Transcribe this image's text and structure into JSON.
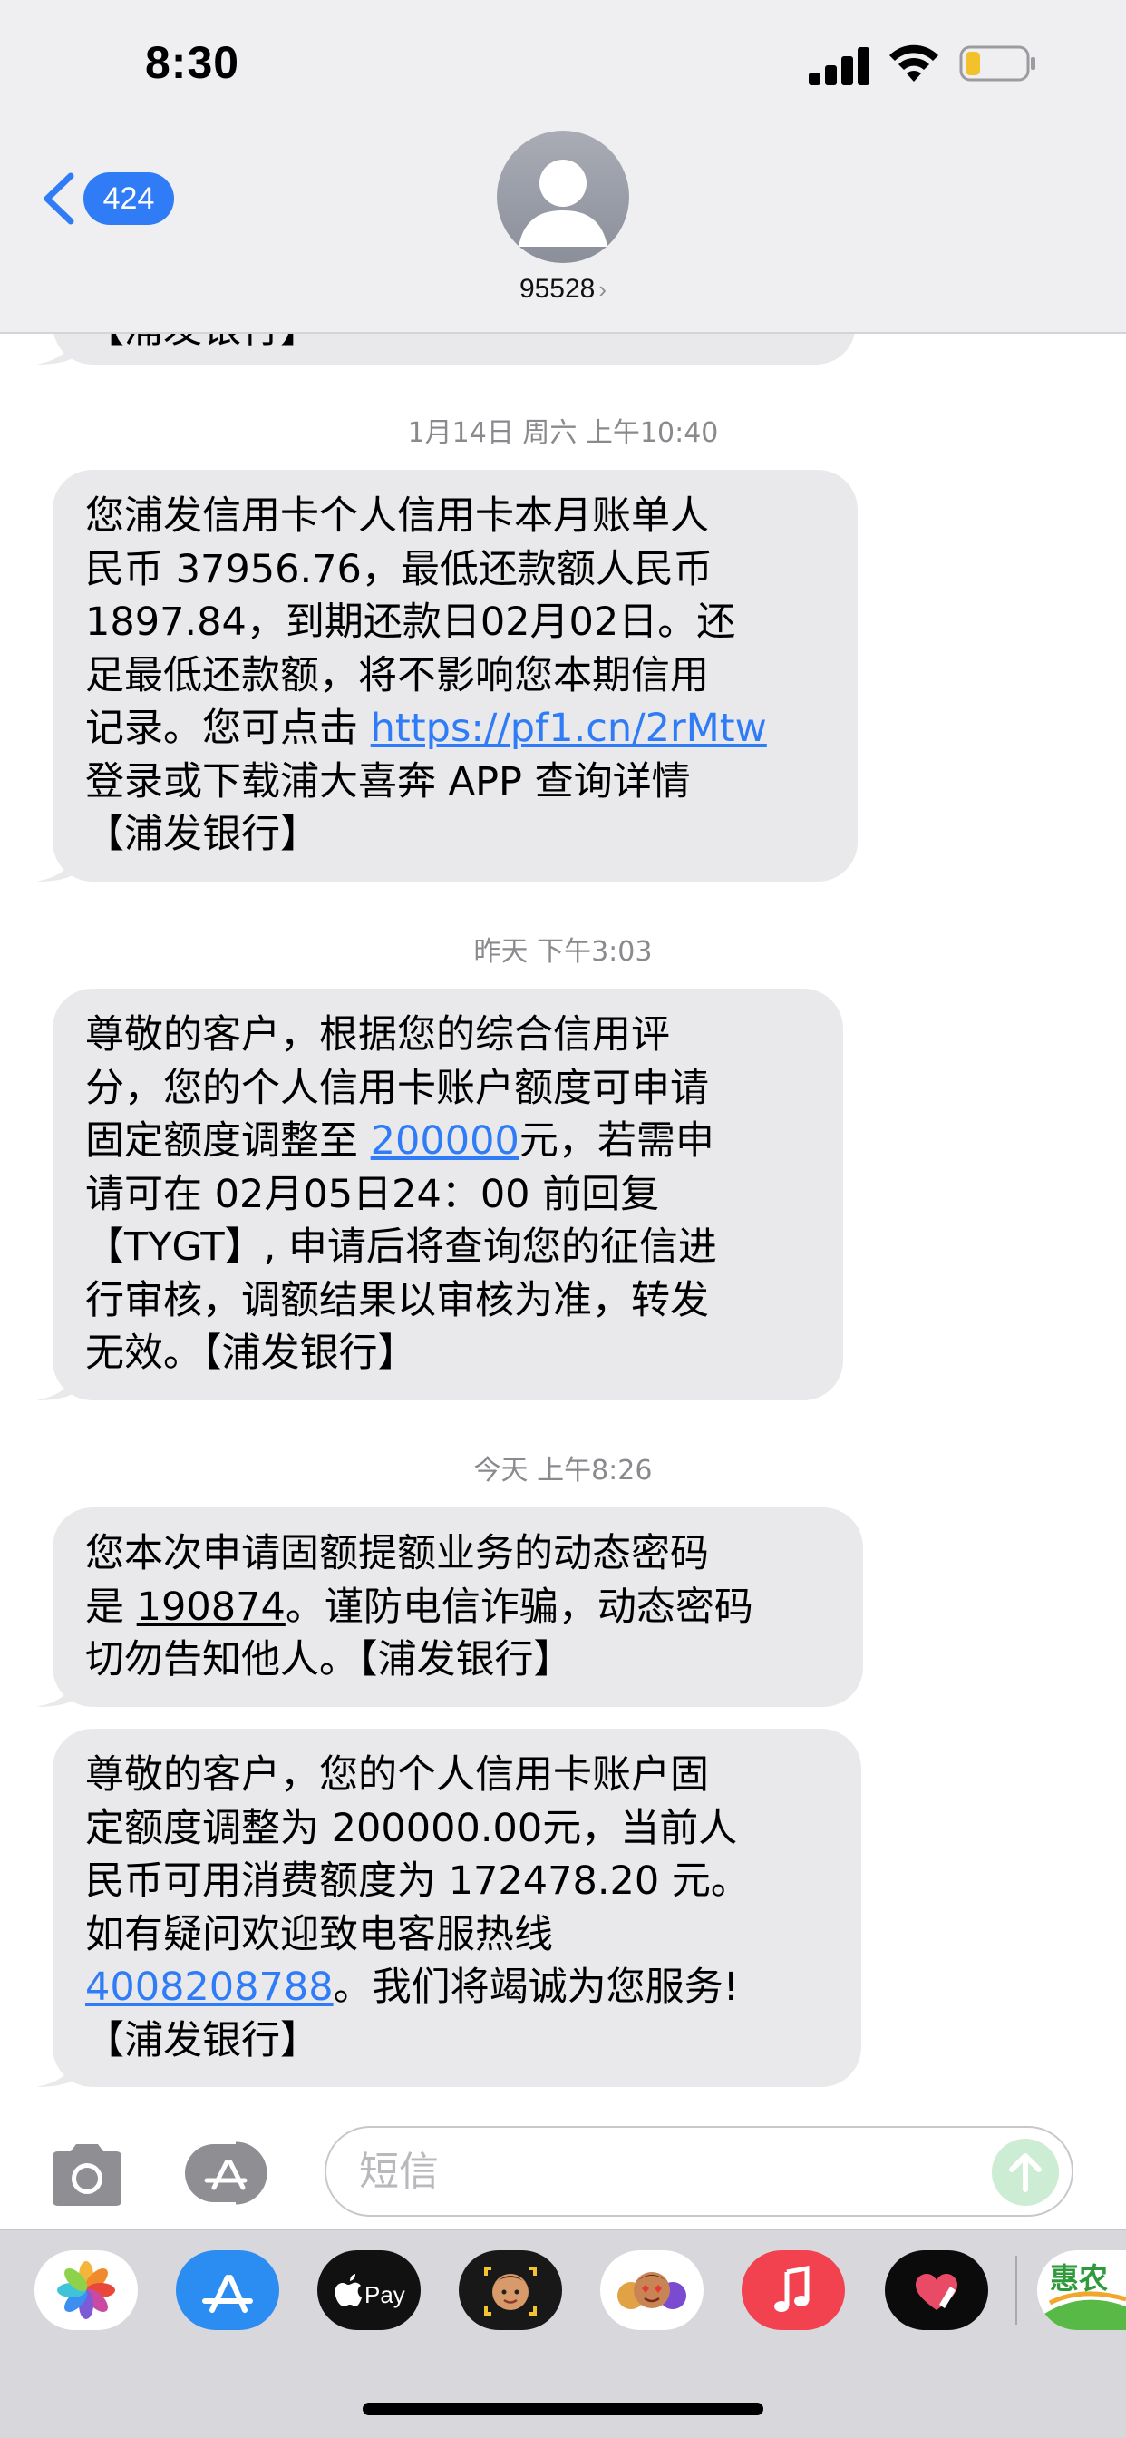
{
  "status_bar": {
    "time": "8:30"
  },
  "nav": {
    "back_count": "424",
    "contact": "95528",
    "contact_chevron": "›"
  },
  "colors": {
    "accent": "#2f7cf6",
    "bubble": "#e9e9eb",
    "header": "#efeff1"
  },
  "thread": {
    "cut_message_tail": "【浦发银行】",
    "messages": [
      {
        "timestamp": "1月14日 周六 上午10:40",
        "lines": [
          {
            "text": "您浦发信用卡个人信用卡本月账单人"
          },
          {
            "text": "民币 37956.76，最低还款额人民币"
          },
          {
            "text": "1897.84，到期还款日02月02日。还"
          },
          {
            "text": "足最低还款额，将不影响您本期信用"
          },
          {
            "pre": "记录。您可点击 ",
            "link": "https://pf1.cn/2rMtw"
          },
          {
            "text": "登录或下载浦大喜奔 APP 查询详情"
          },
          {
            "text": "【浦发银行】"
          }
        ]
      },
      {
        "timestamp": "昨天 下午3:03",
        "lines": [
          {
            "text": "尊敬的客户，根据您的综合信用评"
          },
          {
            "text": "分，您的个人信用卡账户额度可申请"
          },
          {
            "pre": "固定额度调整至 ",
            "link": "200000",
            "post": "元，若需申"
          },
          {
            "text": "请可在 02月05日24：00 前回复"
          },
          {
            "text": "【TYGT】, 申请后将查询您的征信进"
          },
          {
            "text": "行审核，调额结果以审核为准，转发"
          },
          {
            "text": "无效。【浦发银行】"
          }
        ]
      },
      {
        "timestamp": "今天 上午8:26",
        "lines": [
          {
            "text": "您本次申请固额提额业务的动态密码"
          },
          {
            "pre": "是 ",
            "code": "190874",
            "post": "。谨防电信诈骗，动态密码"
          },
          {
            "text": "切勿告知他人。【浦发银行】"
          }
        ]
      },
      {
        "timestamp": "",
        "lines": [
          {
            "text": "尊敬的客户，您的个人信用卡账户固"
          },
          {
            "text": "定额度调整为 200000.00元，当前人"
          },
          {
            "text": "民币可用消费额度为 172478.20 元。"
          },
          {
            "text": "如有疑问欢迎致电客服热线"
          },
          {
            "link": "4008208788",
            "post": "。我们将竭诚为您服务!"
          },
          {
            "text": "【浦发银行】"
          }
        ]
      }
    ]
  },
  "composer": {
    "placeholder": "短信"
  },
  "app_drawer": {
    "apps": [
      {
        "name": "photos-app",
        "icon": "photos-icon"
      },
      {
        "name": "app-store-app",
        "icon": "app-store-icon"
      },
      {
        "name": "apple-pay-app",
        "icon": "apple-pay-icon",
        "label": "Pay"
      },
      {
        "name": "memoji-app",
        "icon": "memoji-icon"
      },
      {
        "name": "animoji-stickers-app",
        "icon": "memoji-stickers-icon"
      },
      {
        "name": "music-app",
        "icon": "music-icon"
      },
      {
        "name": "digital-touch-app",
        "icon": "digital-touch-icon"
      },
      {
        "name": "huinong-app",
        "icon": "huinong-icon",
        "label": "惠农"
      }
    ]
  }
}
